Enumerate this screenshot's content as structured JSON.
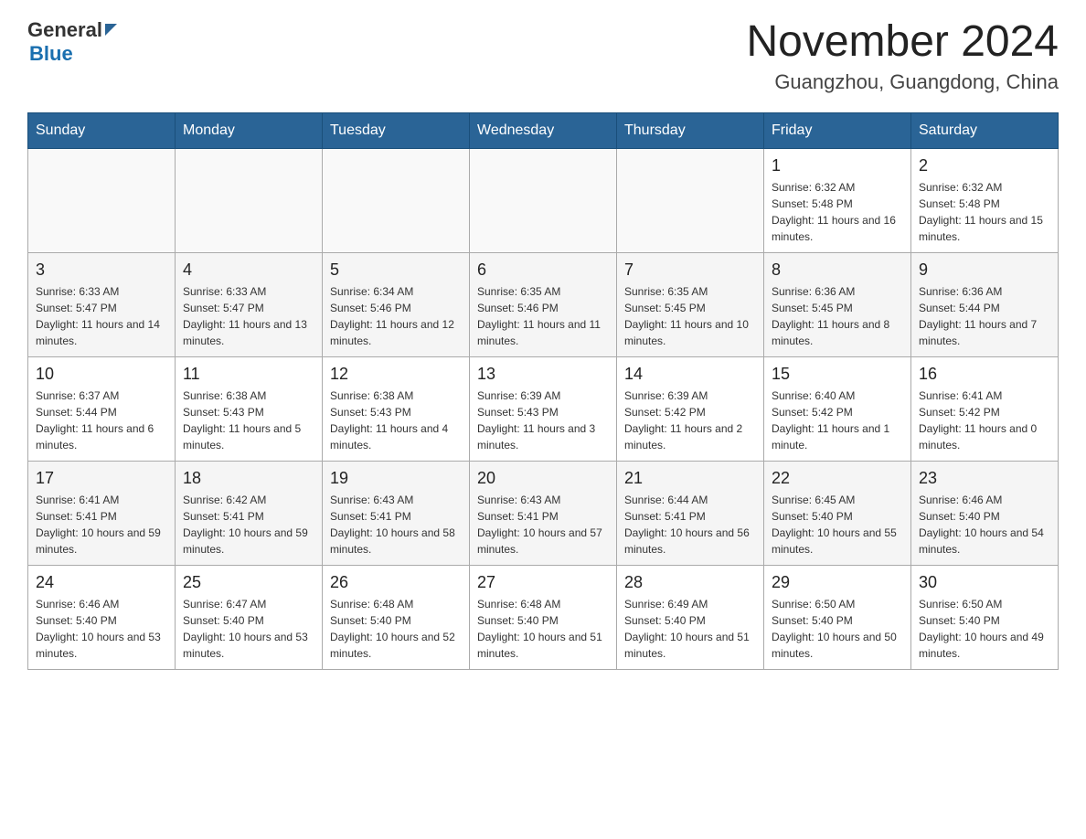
{
  "header": {
    "logo_general": "General",
    "logo_blue": "Blue",
    "month_title": "November 2024",
    "location": "Guangzhou, Guangdong, China"
  },
  "days_of_week": [
    "Sunday",
    "Monday",
    "Tuesday",
    "Wednesday",
    "Thursday",
    "Friday",
    "Saturday"
  ],
  "weeks": [
    [
      {
        "day": "",
        "info": ""
      },
      {
        "day": "",
        "info": ""
      },
      {
        "day": "",
        "info": ""
      },
      {
        "day": "",
        "info": ""
      },
      {
        "day": "",
        "info": ""
      },
      {
        "day": "1",
        "info": "Sunrise: 6:32 AM\nSunset: 5:48 PM\nDaylight: 11 hours and 16 minutes."
      },
      {
        "day": "2",
        "info": "Sunrise: 6:32 AM\nSunset: 5:48 PM\nDaylight: 11 hours and 15 minutes."
      }
    ],
    [
      {
        "day": "3",
        "info": "Sunrise: 6:33 AM\nSunset: 5:47 PM\nDaylight: 11 hours and 14 minutes."
      },
      {
        "day": "4",
        "info": "Sunrise: 6:33 AM\nSunset: 5:47 PM\nDaylight: 11 hours and 13 minutes."
      },
      {
        "day": "5",
        "info": "Sunrise: 6:34 AM\nSunset: 5:46 PM\nDaylight: 11 hours and 12 minutes."
      },
      {
        "day": "6",
        "info": "Sunrise: 6:35 AM\nSunset: 5:46 PM\nDaylight: 11 hours and 11 minutes."
      },
      {
        "day": "7",
        "info": "Sunrise: 6:35 AM\nSunset: 5:45 PM\nDaylight: 11 hours and 10 minutes."
      },
      {
        "day": "8",
        "info": "Sunrise: 6:36 AM\nSunset: 5:45 PM\nDaylight: 11 hours and 8 minutes."
      },
      {
        "day": "9",
        "info": "Sunrise: 6:36 AM\nSunset: 5:44 PM\nDaylight: 11 hours and 7 minutes."
      }
    ],
    [
      {
        "day": "10",
        "info": "Sunrise: 6:37 AM\nSunset: 5:44 PM\nDaylight: 11 hours and 6 minutes."
      },
      {
        "day": "11",
        "info": "Sunrise: 6:38 AM\nSunset: 5:43 PM\nDaylight: 11 hours and 5 minutes."
      },
      {
        "day": "12",
        "info": "Sunrise: 6:38 AM\nSunset: 5:43 PM\nDaylight: 11 hours and 4 minutes."
      },
      {
        "day": "13",
        "info": "Sunrise: 6:39 AM\nSunset: 5:43 PM\nDaylight: 11 hours and 3 minutes."
      },
      {
        "day": "14",
        "info": "Sunrise: 6:39 AM\nSunset: 5:42 PM\nDaylight: 11 hours and 2 minutes."
      },
      {
        "day": "15",
        "info": "Sunrise: 6:40 AM\nSunset: 5:42 PM\nDaylight: 11 hours and 1 minute."
      },
      {
        "day": "16",
        "info": "Sunrise: 6:41 AM\nSunset: 5:42 PM\nDaylight: 11 hours and 0 minutes."
      }
    ],
    [
      {
        "day": "17",
        "info": "Sunrise: 6:41 AM\nSunset: 5:41 PM\nDaylight: 10 hours and 59 minutes."
      },
      {
        "day": "18",
        "info": "Sunrise: 6:42 AM\nSunset: 5:41 PM\nDaylight: 10 hours and 59 minutes."
      },
      {
        "day": "19",
        "info": "Sunrise: 6:43 AM\nSunset: 5:41 PM\nDaylight: 10 hours and 58 minutes."
      },
      {
        "day": "20",
        "info": "Sunrise: 6:43 AM\nSunset: 5:41 PM\nDaylight: 10 hours and 57 minutes."
      },
      {
        "day": "21",
        "info": "Sunrise: 6:44 AM\nSunset: 5:41 PM\nDaylight: 10 hours and 56 minutes."
      },
      {
        "day": "22",
        "info": "Sunrise: 6:45 AM\nSunset: 5:40 PM\nDaylight: 10 hours and 55 minutes."
      },
      {
        "day": "23",
        "info": "Sunrise: 6:46 AM\nSunset: 5:40 PM\nDaylight: 10 hours and 54 minutes."
      }
    ],
    [
      {
        "day": "24",
        "info": "Sunrise: 6:46 AM\nSunset: 5:40 PM\nDaylight: 10 hours and 53 minutes."
      },
      {
        "day": "25",
        "info": "Sunrise: 6:47 AM\nSunset: 5:40 PM\nDaylight: 10 hours and 53 minutes."
      },
      {
        "day": "26",
        "info": "Sunrise: 6:48 AM\nSunset: 5:40 PM\nDaylight: 10 hours and 52 minutes."
      },
      {
        "day": "27",
        "info": "Sunrise: 6:48 AM\nSunset: 5:40 PM\nDaylight: 10 hours and 51 minutes."
      },
      {
        "day": "28",
        "info": "Sunrise: 6:49 AM\nSunset: 5:40 PM\nDaylight: 10 hours and 51 minutes."
      },
      {
        "day": "29",
        "info": "Sunrise: 6:50 AM\nSunset: 5:40 PM\nDaylight: 10 hours and 50 minutes."
      },
      {
        "day": "30",
        "info": "Sunrise: 6:50 AM\nSunset: 5:40 PM\nDaylight: 10 hours and 49 minutes."
      }
    ]
  ]
}
